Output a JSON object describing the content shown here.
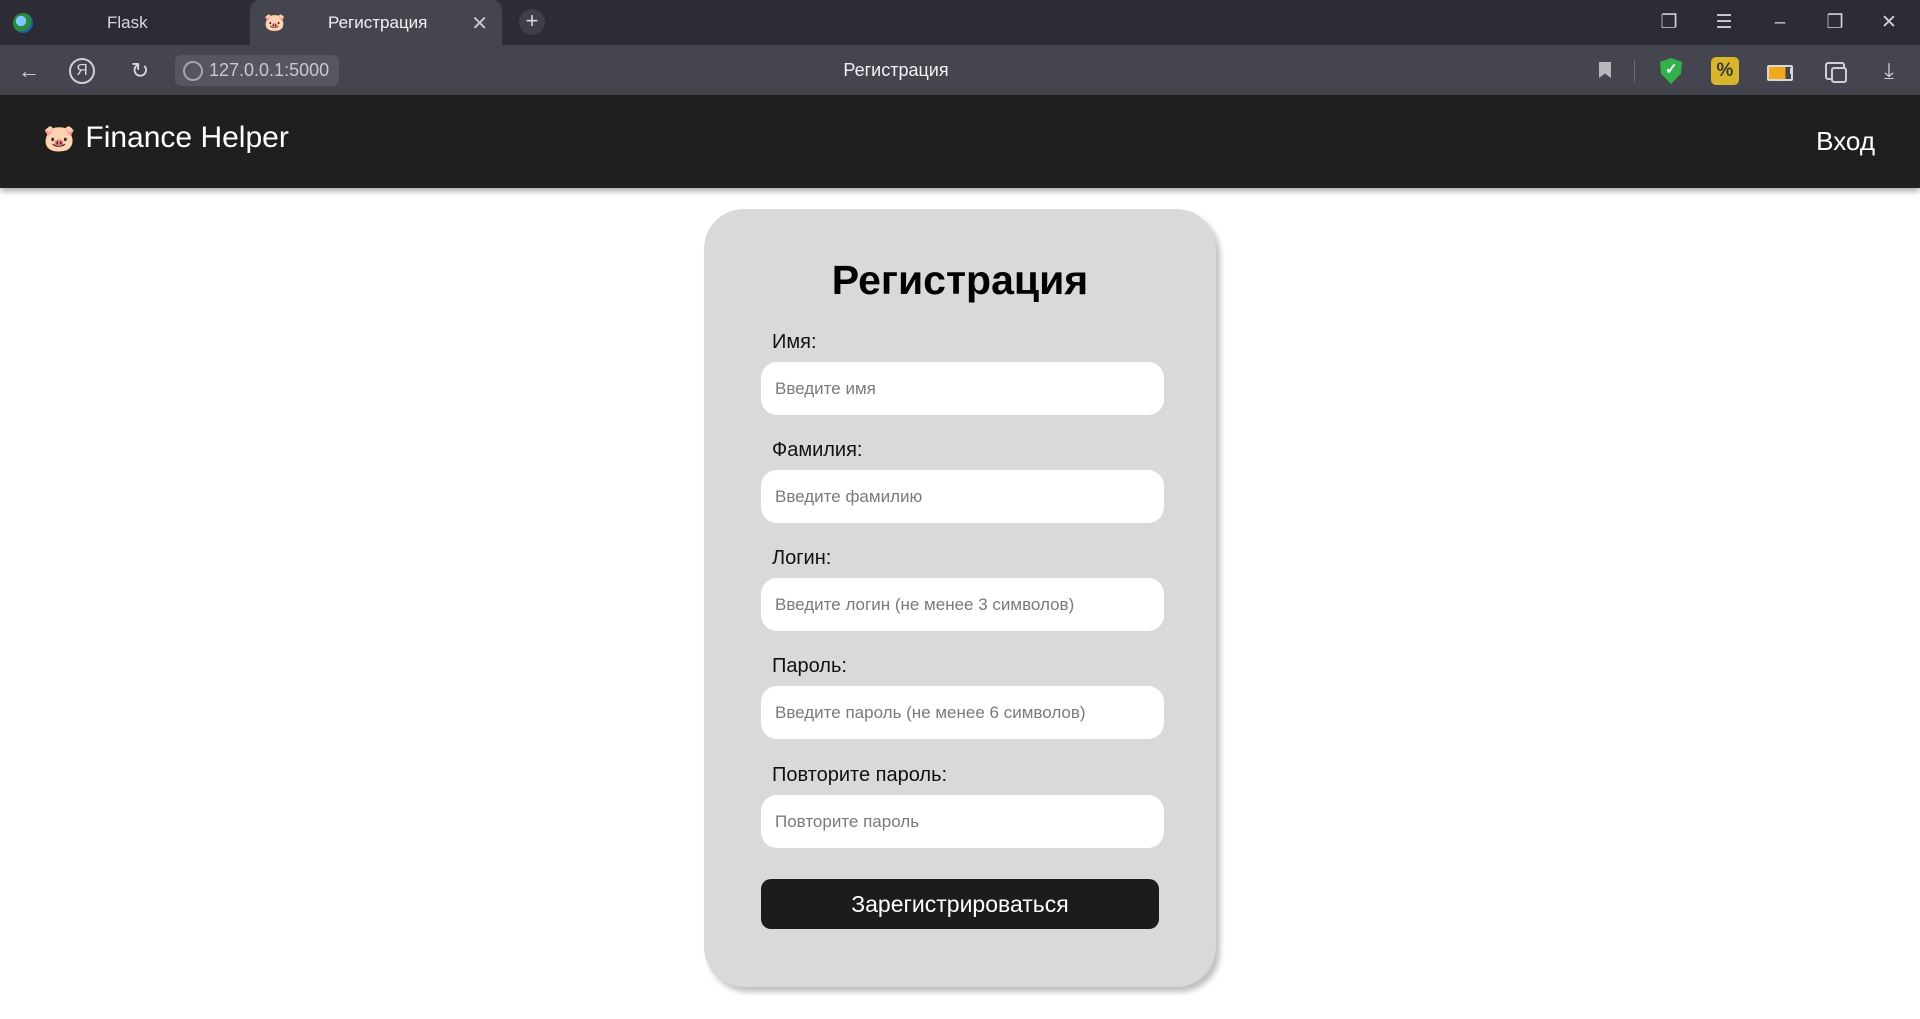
{
  "browser": {
    "tabs": [
      {
        "title": "Flask",
        "favicon": "flask-icon"
      },
      {
        "title": "Регистрация",
        "favicon": "piggy-bank-icon"
      }
    ],
    "url": "127.0.0.1:5000",
    "page_title": "Регистрация"
  },
  "header": {
    "brand_icon": "🐷",
    "brand": "Finance Helper",
    "login": "Вход"
  },
  "form": {
    "title": "Регистрация",
    "fields": [
      {
        "label": "Имя:",
        "placeholder": "Введите имя"
      },
      {
        "label": "Фамилия:",
        "placeholder": "Введите фамилию"
      },
      {
        "label": "Логин:",
        "placeholder": "Введите логин (не менее 3 символов)"
      },
      {
        "label": "Пароль:",
        "placeholder": "Введите пароль (не менее 6 символов)"
      },
      {
        "label": "Повторите пароль:",
        "placeholder": "Повторите пароль"
      }
    ],
    "submit": "Зарегистрироваться"
  },
  "colors": {
    "header_bg": "#1f1f1f",
    "card_bg": "#d9d9d9",
    "button_bg": "#1c1c1c"
  }
}
